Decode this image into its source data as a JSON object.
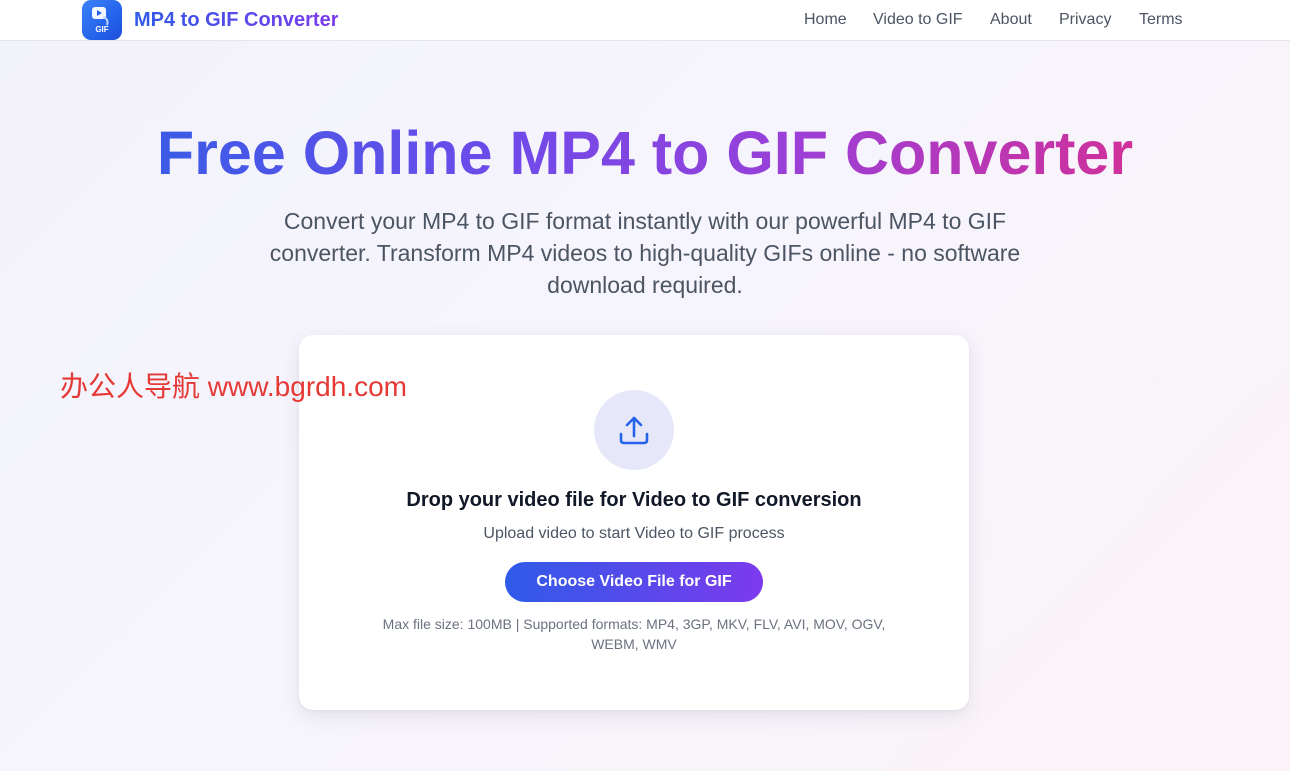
{
  "header": {
    "brand": "MP4 to GIF Converter",
    "logo_text": "GIF",
    "nav": [
      {
        "label": "Home"
      },
      {
        "label": "Video to GIF"
      },
      {
        "label": "About"
      },
      {
        "label": "Privacy"
      },
      {
        "label": "Terms"
      }
    ]
  },
  "hero": {
    "title": "Free Online MP4 to GIF Converter",
    "subtitle": "Convert your MP4 to GIF format instantly with our powerful MP4 to GIF converter. Transform MP4 videos to high-quality GIFs online - no software download required."
  },
  "watermark": "办公人导航  www.bgrdh.com",
  "upload": {
    "icon": "upload-icon",
    "title": "Drop your video file for Video to GIF conversion",
    "subtitle": "Upload video to start Video to GIF process",
    "button_label": "Choose Video File for GIF",
    "limits": "Max file size: 100MB | Supported formats: MP4, 3GP, MKV, FLV, AVI, MOV, OGV, WEBM, WMV"
  },
  "colors": {
    "accent_start": "#2f5be8",
    "accent_end": "#7c3aed",
    "title_end": "#d0309a",
    "watermark": "#e53935"
  }
}
